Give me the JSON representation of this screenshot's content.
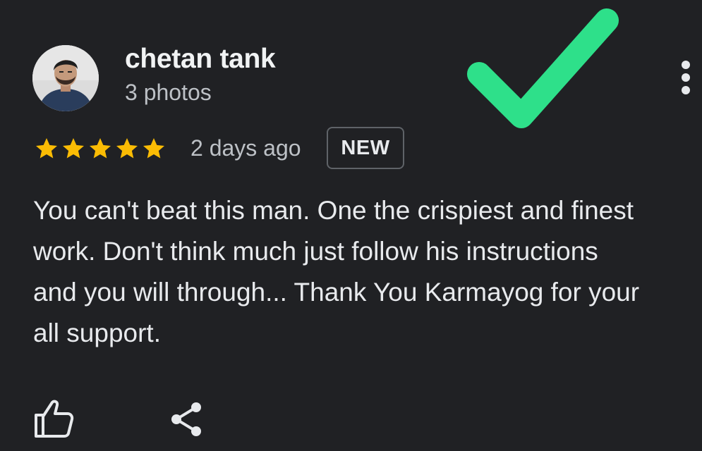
{
  "review": {
    "author": {
      "name": "chetan tank",
      "meta": "3 photos",
      "avatar_icon": "user-photo-avatar"
    },
    "rating": {
      "stars": 5,
      "max": 5,
      "color": "#fbbc04"
    },
    "date": "2 days ago",
    "badge": "NEW",
    "text_lines": [
      "You can't beat this man. One the crispiest and finest",
      "work. Don't think much just follow his instructions",
      "and you will through... Thank You Karmayog for your",
      "all support."
    ],
    "actions": {
      "like_icon": "thumbs-up-icon",
      "share_icon": "share-icon",
      "more_icon": "more-vert-icon"
    }
  },
  "overlay": {
    "icon": "checkmark-icon",
    "color": "#2ee08a"
  }
}
